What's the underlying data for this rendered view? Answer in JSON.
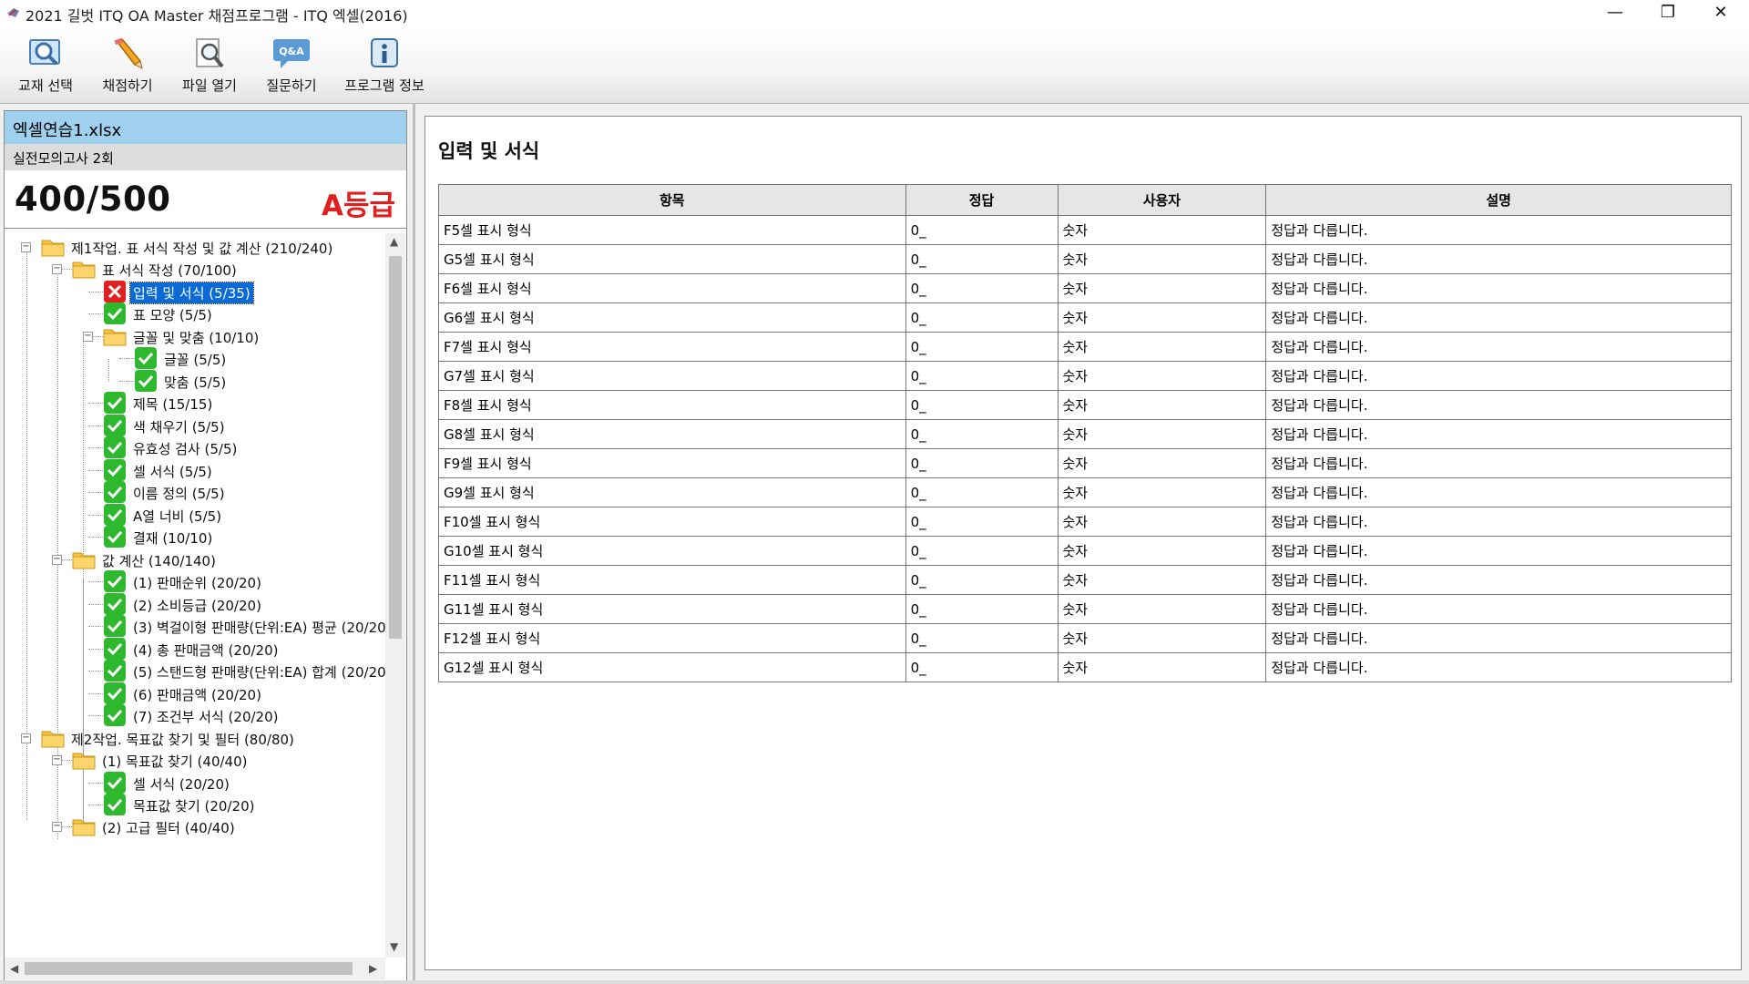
{
  "window": {
    "title": "2021 길벗 ITQ OA Master 채점프로그램 - ITQ 엑셀(2016)",
    "minimize": "—",
    "restore": "❐",
    "close": "✕"
  },
  "toolbar": {
    "select_book": "교재 선택",
    "grade": "채점하기",
    "open_file": "파일 열기",
    "ask": "질문하기",
    "program_info": "프로그램 정보",
    "qa_icon_text": "Q&A"
  },
  "left": {
    "file_name": "엑셀연습1.xlsx",
    "exam_name": "실전모의고사 2회",
    "score": "400/500",
    "grade": "A등급"
  },
  "tree": [
    {
      "label": "제1작업. 표 서식 작성 및 값 계산 (210/240)",
      "icon": "folder"
    },
    {
      "label": "표 서식 작성 (70/100)",
      "icon": "folder"
    },
    {
      "label": "입력 및 서식 (5/35)",
      "icon": "fail"
    },
    {
      "label": "표 모양 (5/5)",
      "icon": "pass"
    },
    {
      "label": "글꼴 및 맞춤 (10/10)",
      "icon": "folder"
    },
    {
      "label": "글꼴 (5/5)",
      "icon": "pass"
    },
    {
      "label": "맞춤 (5/5)",
      "icon": "pass"
    },
    {
      "label": "제목 (15/15)",
      "icon": "pass"
    },
    {
      "label": "색 채우기 (5/5)",
      "icon": "pass"
    },
    {
      "label": "유효성 검사 (5/5)",
      "icon": "pass"
    },
    {
      "label": "셀 서식 (5/5)",
      "icon": "pass"
    },
    {
      "label": "이름 정의 (5/5)",
      "icon": "pass"
    },
    {
      "label": "A열 너비 (5/5)",
      "icon": "pass"
    },
    {
      "label": "결재 (10/10)",
      "icon": "pass"
    },
    {
      "label": "값 계산 (140/140)",
      "icon": "folder"
    },
    {
      "label": "(1) 판매순위 (20/20)",
      "icon": "pass"
    },
    {
      "label": "(2) 소비등급 (20/20)",
      "icon": "pass"
    },
    {
      "label": "(3) 벽걸이형 판매량(단위:EA) 평균 (20/20",
      "icon": "pass"
    },
    {
      "label": "(4) 총 판매금액 (20/20)",
      "icon": "pass"
    },
    {
      "label": "(5) 스탠드형 판매량(단위:EA) 합계 (20/20",
      "icon": "pass"
    },
    {
      "label": "(6) 판매금액 (20/20)",
      "icon": "pass"
    },
    {
      "label": "(7) 조건부 서식 (20/20)",
      "icon": "pass"
    },
    {
      "label": "제2작업. 목표값 찾기 및 필터 (80/80)",
      "icon": "folder"
    },
    {
      "label": "(1) 목표값 찾기 (40/40)",
      "icon": "folder"
    },
    {
      "label": "셀 서식 (20/20)",
      "icon": "pass"
    },
    {
      "label": "목표값 찾기 (20/20)",
      "icon": "pass"
    },
    {
      "label": "(2) 고급 필터 (40/40)",
      "icon": "folder"
    }
  ],
  "main": {
    "section_title": "입력 및 서식",
    "columns": [
      "항목",
      "정답",
      "사용자",
      "설명"
    ],
    "rows": [
      [
        "F5셀 표시 형식",
        "0_",
        "숫자",
        "정답과 다릅니다."
      ],
      [
        "G5셀 표시 형식",
        "0_",
        "숫자",
        "정답과 다릅니다."
      ],
      [
        "F6셀 표시 형식",
        "0_",
        "숫자",
        "정답과 다릅니다."
      ],
      [
        "G6셀 표시 형식",
        "0_",
        "숫자",
        "정답과 다릅니다."
      ],
      [
        "F7셀 표시 형식",
        "0_",
        "숫자",
        "정답과 다릅니다."
      ],
      [
        "G7셀 표시 형식",
        "0_",
        "숫자",
        "정답과 다릅니다."
      ],
      [
        "F8셀 표시 형식",
        "0_",
        "숫자",
        "정답과 다릅니다."
      ],
      [
        "G8셀 표시 형식",
        "0_",
        "숫자",
        "정답과 다릅니다."
      ],
      [
        "F9셀 표시 형식",
        "0_",
        "숫자",
        "정답과 다릅니다."
      ],
      [
        "G9셀 표시 형식",
        "0_",
        "숫자",
        "정답과 다릅니다."
      ],
      [
        "F10셀 표시 형식",
        "0_",
        "숫자",
        "정답과 다릅니다."
      ],
      [
        "G10셀 표시 형식",
        "0_",
        "숫자",
        "정답과 다릅니다."
      ],
      [
        "F11셀 표시 형식",
        "0_",
        "숫자",
        "정답과 다릅니다."
      ],
      [
        "G11셀 표시 형식",
        "0_",
        "숫자",
        "정답과 다릅니다."
      ],
      [
        "F12셀 표시 형식",
        "0_",
        "숫자",
        "정답과 다릅니다."
      ],
      [
        "G12셀 표시 형식",
        "0_",
        "숫자",
        "정답과 다릅니다."
      ]
    ]
  },
  "colors": {
    "file_header_bg": "#9fd1ef",
    "grade_red": "#e02020",
    "pass_green": "#2eb82e",
    "fail_red": "#e02020",
    "selection_blue": "#0a6ad8"
  }
}
